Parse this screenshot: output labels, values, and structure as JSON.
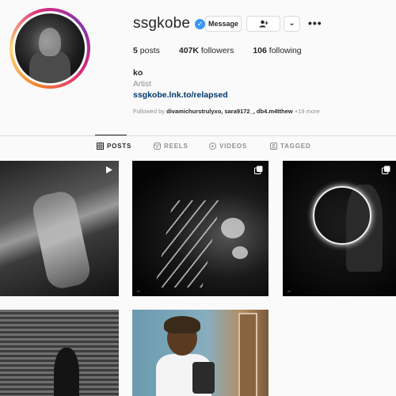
{
  "profile": {
    "username": "ssgkobe",
    "verified_mark": "✓",
    "name": "ko",
    "category": "Artist",
    "link": "ssgkobe.lnk.to/relapsed",
    "followed_by_prefix": "Followed by ",
    "followed_by_users": "divamichurstrulyxo, sara9172_, db4.m4tthew",
    "followed_by_more": " +19 more"
  },
  "actions": {
    "message_label": "Message",
    "more_label": "⌄",
    "options_label": "•••"
  },
  "stats": {
    "posts_count": "5",
    "posts_label": " posts",
    "followers_count": "407K",
    "followers_label": " followers",
    "following_count": "106",
    "following_label": " following"
  },
  "tabs": [
    {
      "label": "POSTS",
      "icon": "grid-icon",
      "active": true
    },
    {
      "label": "REELS",
      "icon": "reels-icon",
      "active": false
    },
    {
      "label": "VIDEOS",
      "icon": "videos-icon",
      "active": false
    },
    {
      "label": "TAGGED",
      "icon": "tagged-icon",
      "active": false
    }
  ],
  "posts": [
    {
      "type": "reel",
      "badge_icon": "play-icon"
    },
    {
      "type": "carousel",
      "badge_icon": "carousel-icon"
    },
    {
      "type": "carousel",
      "badge_icon": "carousel-icon"
    },
    {
      "type": "image",
      "badge_icon": ""
    },
    {
      "type": "image",
      "badge_icon": ""
    }
  ],
  "colors": {
    "background": "#fafafa",
    "text": "#262626",
    "muted": "#8e8e8e",
    "link": "#00376b",
    "verified": "#3897f0",
    "border": "#dbdbdb"
  }
}
